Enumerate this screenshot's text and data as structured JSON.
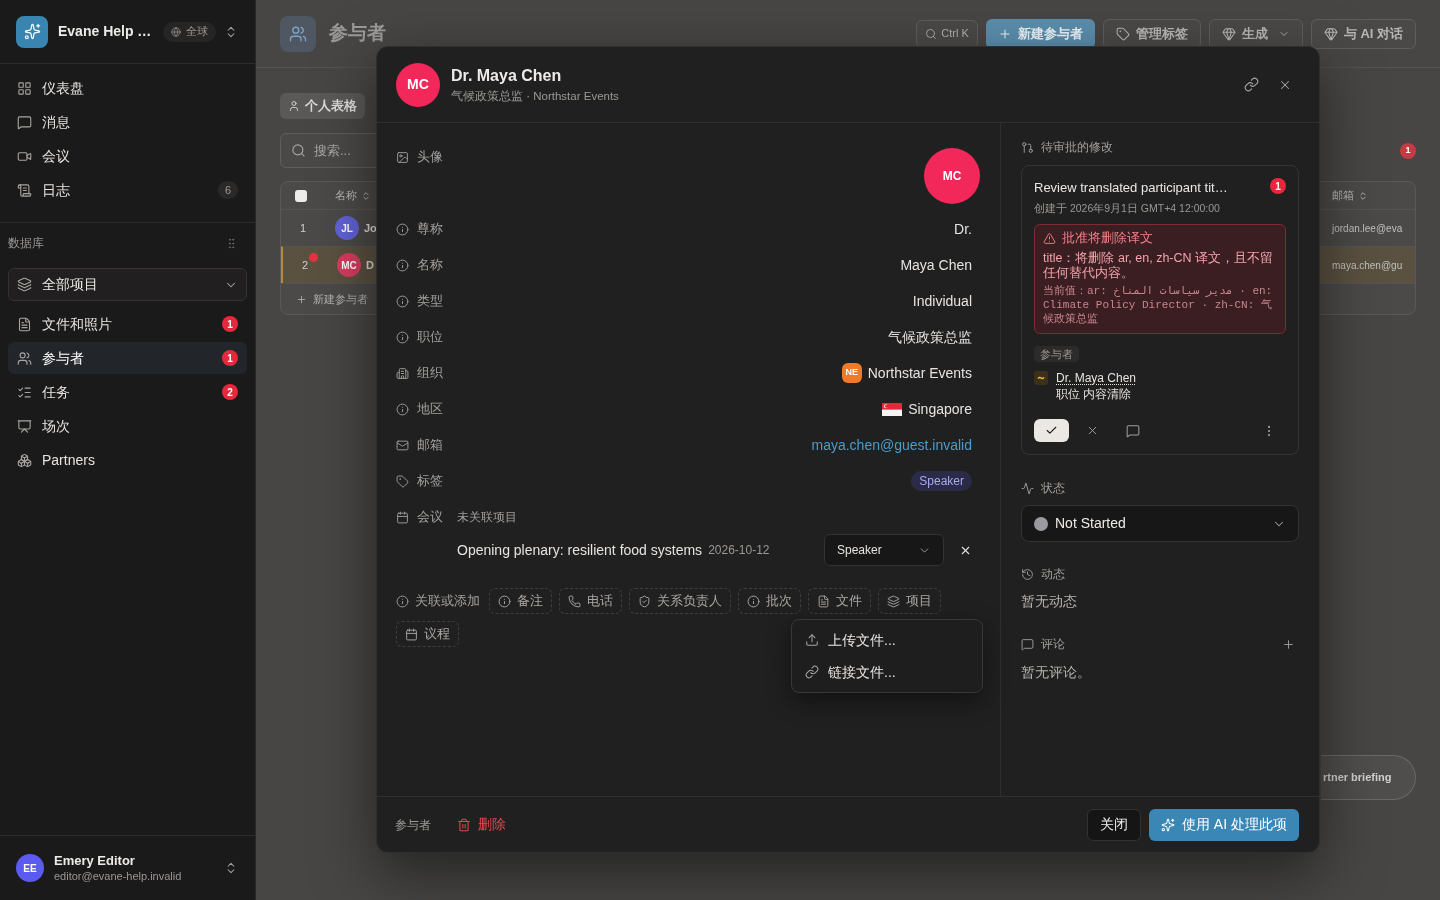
{
  "sidebar": {
    "workspace": {
      "name": "Evane Help …",
      "scope": "全球"
    },
    "nav": [
      {
        "label": "仪表盘",
        "kind": "dashboard",
        "selected": false
      },
      {
        "label": "消息",
        "kind": "messages",
        "selected": false
      },
      {
        "label": "会议",
        "kind": "meetings",
        "selected": false
      },
      {
        "label": "日志",
        "kind": "log",
        "count": "6",
        "selected": false
      }
    ],
    "database": {
      "title": "数据库",
      "scope": "全部项目",
      "items": [
        {
          "label": "文件和照片",
          "kind": "files",
          "count": "1",
          "selected": false
        },
        {
          "label": "参与者",
          "kind": "participants",
          "count": "1",
          "selected": true
        },
        {
          "label": "任务",
          "kind": "tasks",
          "count": "2",
          "selected": false
        },
        {
          "label": "场次",
          "kind": "sessions",
          "selected": false
        },
        {
          "label": "Partners",
          "kind": "partners",
          "selected": false
        }
      ]
    },
    "user": {
      "initials": "EE",
      "name": "Emery Editor",
      "email": "editor@evane-help.invalid"
    }
  },
  "page": {
    "title": "参与者",
    "search_shortcut": "Ctrl K",
    "actions": [
      {
        "label": "新建参与者",
        "kind": "create"
      },
      {
        "label": "管理标签",
        "kind": "tags"
      },
      {
        "label": "生成",
        "kind": "generate"
      },
      {
        "label": "与 AI 对话",
        "kind": "chat"
      }
    ],
    "view": {
      "label": "个人表格",
      "selected": true
    },
    "search": {
      "placeholder": "搜索..."
    },
    "notice_count": "1",
    "table": {
      "select_all": {
        "checked": false
      },
      "columns": [
        "名称",
        "邮箱"
      ],
      "rows": [
        {
          "index": "1",
          "initials": "JL",
          "color": "#6262d8",
          "name": "Jo",
          "email": "jordan.lee@eva",
          "selected": false,
          "flagged": false
        },
        {
          "index": "2",
          "initials": "MC",
          "color": "#d83c60",
          "name": "D",
          "email": "maya.chen@gu",
          "selected": true,
          "flagged": true
        }
      ],
      "add_row": "新建参与者"
    },
    "floating_button": "rtner briefing"
  },
  "dialog": {
    "header": {
      "initials": "MC",
      "name": "Dr. Maya Chen",
      "subtitle": "气候政策总监 · Northstar Events"
    },
    "fields": [
      {
        "kind": "avatar",
        "label": "头像",
        "initials": "MC"
      },
      {
        "kind": "text",
        "label": "尊称",
        "value": "Dr."
      },
      {
        "kind": "text",
        "label": "名称",
        "value": "Maya Chen"
      },
      {
        "kind": "text",
        "label": "类型",
        "value": "Individual"
      },
      {
        "kind": "text",
        "label": "职位",
        "value": "气候政策总监"
      },
      {
        "kind": "organization",
        "label": "组织",
        "initials": "NE",
        "value": "Northstar Events"
      },
      {
        "kind": "region",
        "label": "地区",
        "value": "Singapore"
      },
      {
        "kind": "email",
        "label": "邮箱",
        "value": "maya.chen@guest.invalid"
      },
      {
        "kind": "tags",
        "label": "标签",
        "tags": [
          "Speaker"
        ]
      },
      {
        "kind": "meetings",
        "label": "会议",
        "project": "未关联项目",
        "meetings": [
          {
            "title": "Opening plenary: resilient food systems",
            "date": "2026-10-12",
            "role": "Speaker"
          }
        ]
      }
    ],
    "links": {
      "label": "关联或添加",
      "chips": [
        {
          "label": "备注",
          "kind": "note"
        },
        {
          "label": "电话",
          "kind": "phone"
        },
        {
          "label": "关系负责人",
          "kind": "owner"
        },
        {
          "label": "批次",
          "kind": "batch"
        },
        {
          "label": "文件",
          "kind": "file"
        },
        {
          "label": "项目",
          "kind": "project"
        },
        {
          "label": "议程",
          "kind": "agenda"
        }
      ]
    },
    "file_menu": {
      "items": [
        {
          "label": "上传文件...",
          "kind": "upload"
        },
        {
          "label": "链接文件...",
          "kind": "link"
        }
      ]
    },
    "side": {
      "pending": {
        "title": "待审批的修改",
        "changes": [
          {
            "title": "Review translated participant tit…",
            "count": "1",
            "created": "创建于 2026年9月1日 GMT+4 12:00:00",
            "warning": {
              "title": "批准将删除译文",
              "message": "title：将删除 ar, en, zh-CN 译文，且不留任何替代内容。",
              "current": "当前值：ar: مدير سياسات المناخ · en: Climate Policy Director · zh-CN: 气候政策总监"
            },
            "entity_type": "参与者",
            "entity": "Dr. Maya Chen",
            "change": "职位 内容清除"
          }
        ]
      },
      "status": {
        "label": "状态",
        "value": "Not Started",
        "color": "#9b9aa0"
      },
      "activity": {
        "label": "动态",
        "empty": "暂无动态"
      },
      "comments": {
        "label": "评论",
        "empty": "暂无评论。"
      }
    },
    "footer": {
      "entity": "参与者",
      "delete": "删除",
      "close": "关闭",
      "ai_action": "使用 AI 处理此项"
    }
  }
}
